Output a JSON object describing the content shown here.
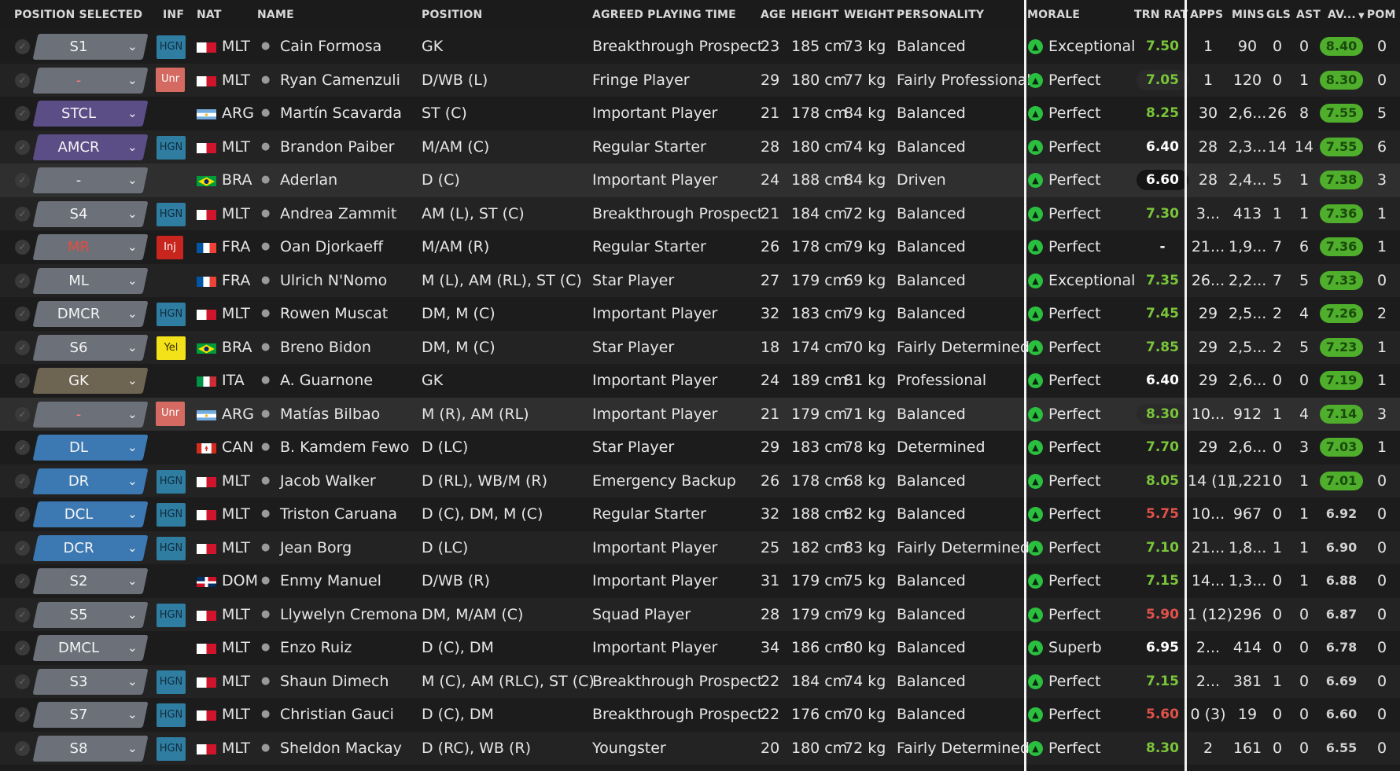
{
  "headers": {
    "position_selected": "POSITION SELECTED",
    "inf": "INF",
    "nat": "NAT",
    "name": "NAME",
    "position": "POSITION",
    "playing_time": "AGREED PLAYING TIME",
    "age": "AGE",
    "height": "HEIGHT",
    "weight": "WEIGHT",
    "personality": "PERSONALITY",
    "morale": "MORALE",
    "trn_rat": "TRN RAT",
    "apps": "APPS",
    "mins": "MINS",
    "gls": "GLS",
    "ast": "AST",
    "av": "AV...",
    "pom": "POM",
    "sort_icon": "sort-desc-icon"
  },
  "colors": {
    "pos_gray": "#6b7079",
    "pos_purple": "#5b4d86",
    "pos_blue": "#3c79b3",
    "pos_gk": "#6e6452",
    "hgn": "#2f7da1",
    "trn_green": "#7ac53a",
    "trn_red": "#e1524a",
    "av_green": "#4fae2b",
    "morale_green": "#2bbf3f"
  },
  "players": [
    {
      "pos": "S1",
      "pos_type": "gray",
      "inf": "HGN",
      "nat": "MLT",
      "name": "Cain Formosa",
      "position": "GK",
      "pt": "Breakthrough Prospect",
      "age": "23",
      "height": "185 cm",
      "weight": "73 kg",
      "personality": "Balanced",
      "morale": "Exceptional",
      "trn": "7.50",
      "trn_style": "green",
      "apps": "1",
      "mins": "90",
      "gls": "0",
      "ast": "0",
      "av": "8.40",
      "av_style": "green",
      "pom": "0"
    },
    {
      "pos": "-",
      "pos_type": "none",
      "inf": "Unr",
      "nat": "MLT",
      "name": "Ryan Camenzuli",
      "position": "D/WB (L)",
      "pt": "Fringe Player",
      "age": "29",
      "height": "180 cm",
      "weight": "77 kg",
      "personality": "Fairly Professional",
      "morale": "Perfect",
      "trn": "7.05",
      "trn_style": "green-dark",
      "apps": "1",
      "mins": "120",
      "gls": "0",
      "ast": "1",
      "av": "8.30",
      "av_style": "green",
      "pom": "0"
    },
    {
      "pos": "STCL",
      "pos_type": "purple",
      "inf": "",
      "nat": "ARG",
      "name": "Martín Scavarda",
      "position": "ST (C)",
      "pt": "Important Player",
      "age": "21",
      "height": "178 cm",
      "weight": "84 kg",
      "personality": "Balanced",
      "morale": "Perfect",
      "trn": "8.25",
      "trn_style": "green",
      "apps": "30",
      "mins": "2,6...",
      "gls": "26",
      "ast": "8",
      "av": "7.55",
      "av_style": "green",
      "pom": "5"
    },
    {
      "pos": "AMCR",
      "pos_type": "purple",
      "inf": "HGN",
      "nat": "MLT",
      "name": "Brandon Paiber",
      "position": "M/AM (C)",
      "pt": "Regular Starter",
      "age": "28",
      "height": "180 cm",
      "weight": "74 kg",
      "personality": "Balanced",
      "morale": "Perfect",
      "trn": "6.40",
      "trn_style": "white",
      "apps": "28",
      "mins": "2,3...",
      "gls": "14",
      "ast": "14",
      "av": "7.55",
      "av_style": "green",
      "pom": "6"
    },
    {
      "pos": "-",
      "pos_type": "gray-plain",
      "inf": "",
      "nat": "BRA",
      "name": "Aderlan",
      "position": "D (C)",
      "pt": "Important Player",
      "age": "24",
      "height": "188 cm",
      "weight": "84 kg",
      "personality": "Driven",
      "morale": "Perfect",
      "trn": "6.60",
      "trn_style": "white-dark",
      "apps": "28",
      "mins": "2,4...",
      "gls": "5",
      "ast": "1",
      "av": "7.38",
      "av_style": "green",
      "pom": "3"
    },
    {
      "pos": "S4",
      "pos_type": "gray",
      "inf": "HGN",
      "nat": "MLT",
      "name": "Andrea Zammit",
      "position": "AM (L), ST (C)",
      "pt": "Breakthrough Prospect",
      "age": "21",
      "height": "184 cm",
      "weight": "72 kg",
      "personality": "Balanced",
      "morale": "Perfect",
      "trn": "7.30",
      "trn_style": "green",
      "apps": "3...",
      "mins": "413",
      "gls": "1",
      "ast": "1",
      "av": "7.36",
      "av_style": "green",
      "pom": "1"
    },
    {
      "pos": "MR",
      "pos_type": "inj",
      "inf": "Inj",
      "nat": "FRA",
      "name": "Oan Djorkaeff",
      "position": "M/AM (R)",
      "pt": "Regular Starter",
      "age": "26",
      "height": "178 cm",
      "weight": "79 kg",
      "personality": "Balanced",
      "morale": "Perfect",
      "trn": "-",
      "trn_style": "white",
      "apps": "21...",
      "mins": "1,9...",
      "gls": "7",
      "ast": "6",
      "av": "7.36",
      "av_style": "green",
      "pom": "1"
    },
    {
      "pos": "ML",
      "pos_type": "gray",
      "inf": "",
      "nat": "FRA",
      "name": "Ulrich N'Nomo",
      "position": "M (L), AM (RL), ST (C)",
      "pt": "Star Player",
      "age": "27",
      "height": "179 cm",
      "weight": "69 kg",
      "personality": "Balanced",
      "morale": "Exceptional",
      "trn": "7.35",
      "trn_style": "green",
      "apps": "26...",
      "mins": "2,2...",
      "gls": "7",
      "ast": "5",
      "av": "7.33",
      "av_style": "green",
      "pom": "0"
    },
    {
      "pos": "DMCR",
      "pos_type": "gray",
      "inf": "HGN",
      "nat": "MLT",
      "name": "Rowen Muscat",
      "position": "DM, M (C)",
      "pt": "Important Player",
      "age": "32",
      "height": "183 cm",
      "weight": "79 kg",
      "personality": "Balanced",
      "morale": "Perfect",
      "trn": "7.45",
      "trn_style": "green",
      "apps": "29",
      "mins": "2,5...",
      "gls": "2",
      "ast": "4",
      "av": "7.26",
      "av_style": "green",
      "pom": "2"
    },
    {
      "pos": "S6",
      "pos_type": "gray",
      "inf": "Yel",
      "nat": "BRA",
      "name": "Breno Bidon",
      "position": "DM, M (C)",
      "pt": "Star Player",
      "age": "18",
      "height": "174 cm",
      "weight": "70 kg",
      "personality": "Fairly Determined",
      "morale": "Perfect",
      "trn": "7.85",
      "trn_style": "green",
      "apps": "29",
      "mins": "2,5...",
      "gls": "2",
      "ast": "5",
      "av": "7.23",
      "av_style": "green",
      "pom": "1"
    },
    {
      "pos": "GK",
      "pos_type": "gk",
      "inf": "",
      "nat": "ITA",
      "name": "A. Guarnone",
      "position": "GK",
      "pt": "Important Player",
      "age": "24",
      "height": "189 cm",
      "weight": "81 kg",
      "personality": "Professional",
      "morale": "Perfect",
      "trn": "6.40",
      "trn_style": "white",
      "apps": "29",
      "mins": "2,6...",
      "gls": "0",
      "ast": "0",
      "av": "7.19",
      "av_style": "green",
      "pom": "1"
    },
    {
      "pos": "-",
      "pos_type": "none",
      "inf": "Unr",
      "nat": "ARG",
      "name": "Matías Bilbao",
      "position": "M (R), AM (RL)",
      "pt": "Important Player",
      "age": "21",
      "height": "179 cm",
      "weight": "71 kg",
      "personality": "Balanced",
      "morale": "Perfect",
      "trn": "8.30",
      "trn_style": "green-dark",
      "apps": "10...",
      "mins": "912",
      "gls": "1",
      "ast": "4",
      "av": "7.14",
      "av_style": "green",
      "pom": "3"
    },
    {
      "pos": "DL",
      "pos_type": "blue",
      "inf": "",
      "nat": "CAN",
      "name": "B. Kamdem Fewo",
      "position": "D (LC)",
      "pt": "Star Player",
      "age": "29",
      "height": "183 cm",
      "weight": "78 kg",
      "personality": "Determined",
      "morale": "Perfect",
      "trn": "7.70",
      "trn_style": "green",
      "apps": "29",
      "mins": "2,6...",
      "gls": "0",
      "ast": "3",
      "av": "7.03",
      "av_style": "green",
      "pom": "1"
    },
    {
      "pos": "DR",
      "pos_type": "blue",
      "inf": "HGN",
      "nat": "MLT",
      "name": "Jacob Walker",
      "position": "D (RL), WB/M (R)",
      "pt": "Emergency Backup",
      "age": "26",
      "height": "178 cm",
      "weight": "68 kg",
      "personality": "Balanced",
      "morale": "Perfect",
      "trn": "8.05",
      "trn_style": "green",
      "apps": "14 (1)",
      "mins": "1,221",
      "gls": "0",
      "ast": "1",
      "av": "7.01",
      "av_style": "green",
      "pom": "0"
    },
    {
      "pos": "DCL",
      "pos_type": "blue",
      "inf": "HGN",
      "nat": "MLT",
      "name": "Triston Caruana",
      "position": "D (C), DM, M (C)",
      "pt": "Regular Starter",
      "age": "32",
      "height": "188 cm",
      "weight": "82 kg",
      "personality": "Balanced",
      "morale": "Perfect",
      "trn": "5.75",
      "trn_style": "red",
      "apps": "10...",
      "mins": "967",
      "gls": "0",
      "ast": "1",
      "av": "6.92",
      "av_style": "plain",
      "pom": "0"
    },
    {
      "pos": "DCR",
      "pos_type": "blue",
      "inf": "HGN",
      "nat": "MLT",
      "name": "Jean Borg",
      "position": "D (LC)",
      "pt": "Important Player",
      "age": "25",
      "height": "182 cm",
      "weight": "83 kg",
      "personality": "Fairly Determined",
      "morale": "Perfect",
      "trn": "7.10",
      "trn_style": "green",
      "apps": "21...",
      "mins": "1,8...",
      "gls": "1",
      "ast": "1",
      "av": "6.90",
      "av_style": "plain",
      "pom": "0"
    },
    {
      "pos": "S2",
      "pos_type": "gray",
      "inf": "",
      "nat": "DOM",
      "name": "Enmy Manuel",
      "position": "D/WB (R)",
      "pt": "Important Player",
      "age": "31",
      "height": "179 cm",
      "weight": "75 kg",
      "personality": "Balanced",
      "morale": "Perfect",
      "trn": "7.15",
      "trn_style": "green",
      "apps": "14...",
      "mins": "1,3...",
      "gls": "0",
      "ast": "1",
      "av": "6.88",
      "av_style": "plain",
      "pom": "0"
    },
    {
      "pos": "S5",
      "pos_type": "gray",
      "inf": "HGN",
      "nat": "MLT",
      "name": "Llywelyn Cremona",
      "position": "DM, M/AM (C)",
      "pt": "Squad Player",
      "age": "28",
      "height": "179 cm",
      "weight": "79 kg",
      "personality": "Balanced",
      "morale": "Perfect",
      "trn": "5.90",
      "trn_style": "red",
      "apps": "1 (12)",
      "mins": "296",
      "gls": "0",
      "ast": "0",
      "av": "6.87",
      "av_style": "plain",
      "pom": "0"
    },
    {
      "pos": "DMCL",
      "pos_type": "gray",
      "inf": "",
      "nat": "MLT",
      "name": "Enzo Ruiz",
      "position": "D (C), DM",
      "pt": "Important Player",
      "age": "34",
      "height": "186 cm",
      "weight": "80 kg",
      "personality": "Balanced",
      "morale": "Superb",
      "trn": "6.95",
      "trn_style": "white",
      "apps": "2...",
      "mins": "414",
      "gls": "0",
      "ast": "0",
      "av": "6.78",
      "av_style": "plain",
      "pom": "0"
    },
    {
      "pos": "S3",
      "pos_type": "gray",
      "inf": "HGN",
      "nat": "MLT",
      "name": "Shaun Dimech",
      "position": "M (C), AM (RLC), ST (C)",
      "pt": "Breakthrough Prospect",
      "age": "22",
      "height": "184 cm",
      "weight": "74 kg",
      "personality": "Balanced",
      "morale": "Perfect",
      "trn": "7.15",
      "trn_style": "green",
      "apps": "2...",
      "mins": "381",
      "gls": "1",
      "ast": "0",
      "av": "6.69",
      "av_style": "plain",
      "pom": "0"
    },
    {
      "pos": "S7",
      "pos_type": "gray",
      "inf": "HGN",
      "nat": "MLT",
      "name": "Christian Gauci",
      "position": "D (C), DM",
      "pt": "Breakthrough Prospect",
      "age": "22",
      "height": "176 cm",
      "weight": "70 kg",
      "personality": "Balanced",
      "morale": "Perfect",
      "trn": "5.60",
      "trn_style": "red",
      "apps": "0 (3)",
      "mins": "19",
      "gls": "0",
      "ast": "0",
      "av": "6.60",
      "av_style": "plain",
      "pom": "0"
    },
    {
      "pos": "S8",
      "pos_type": "gray",
      "inf": "HGN",
      "nat": "MLT",
      "name": "Sheldon Mackay",
      "position": "D (RC), WB (R)",
      "pt": "Youngster",
      "age": "20",
      "height": "180 cm",
      "weight": "72 kg",
      "personality": "Fairly Determined",
      "morale": "Perfect",
      "trn": "8.30",
      "trn_style": "green",
      "apps": "2",
      "mins": "161",
      "gls": "0",
      "ast": "0",
      "av": "6.55",
      "av_style": "plain",
      "pom": "0"
    }
  ]
}
